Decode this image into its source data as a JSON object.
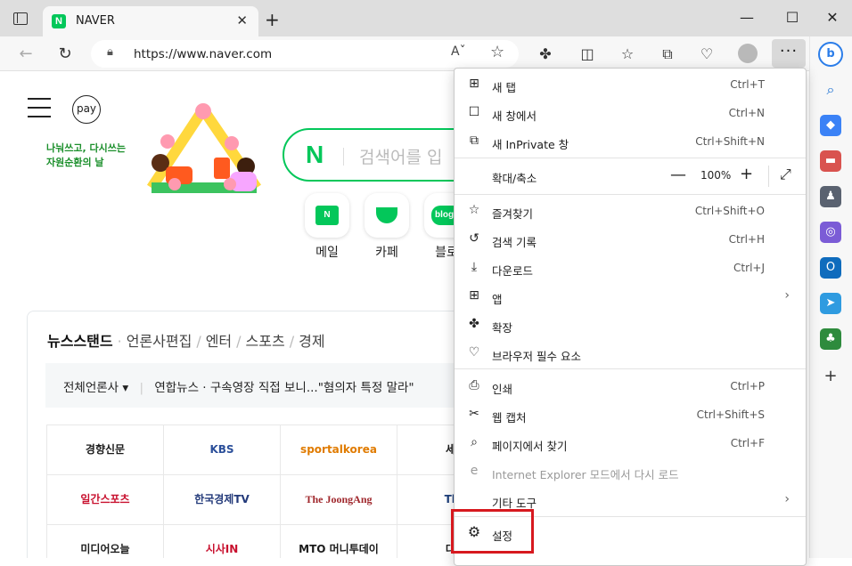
{
  "browser": {
    "tab_title": "NAVER",
    "tab_favicon": "N",
    "new_tab_glyph": "+",
    "url": "https://www.naver.com",
    "read_aloud": "Aˇ",
    "more_glyph": "···"
  },
  "page": {
    "pay_label": "pay",
    "slogan_line1": "나눠쓰고, 다시쓰는",
    "slogan_line2": "자원순환의 날",
    "search_logo": "N",
    "search_placeholder": "검색어를 입",
    "services": [
      {
        "label": "메일"
      },
      {
        "label": "카페"
      },
      {
        "label": "블로"
      }
    ],
    "news_tabs": [
      "뉴스스탠드",
      "언론사편집",
      "엔터",
      "스포츠",
      "경제"
    ],
    "news_filter": "전체언론사 ▾",
    "news_headline": "연합뉴스 · 구속영장 직접 보니...\"혐의자 특정 말라\"",
    "press": [
      [
        "경향신문",
        "KBS",
        "sportalkorea",
        "세계"
      ],
      [
        "일간스포츠",
        "한국경제TV",
        "The JoongAng",
        "The"
      ],
      [
        "미디어오늘",
        "시사IN",
        "MTO 머니투데이",
        "대구"
      ]
    ]
  },
  "menu": {
    "items": [
      {
        "icon": "new-tab-icon",
        "glyph": "⊞",
        "label": "새 탭",
        "shortcut": "Ctrl+T"
      },
      {
        "icon": "new-window-icon",
        "glyph": "☐",
        "label": "새 창에서",
        "shortcut": "Ctrl+N"
      },
      {
        "icon": "inprivate-icon",
        "glyph": "⧉",
        "label": "새 InPrivate 창",
        "shortcut": "Ctrl+Shift+N"
      },
      {
        "icon": "favorites-icon",
        "glyph": "☆",
        "label": "즐겨찾기",
        "shortcut": "Ctrl+Shift+O"
      },
      {
        "icon": "history-icon",
        "glyph": "↺",
        "label": "검색 기록",
        "shortcut": "Ctrl+H"
      },
      {
        "icon": "download-icon",
        "glyph": "⤓",
        "label": "다운로드",
        "shortcut": "Ctrl+J"
      },
      {
        "icon": "apps-icon",
        "glyph": "⊞",
        "label": "앱",
        "shortcut": ""
      },
      {
        "icon": "extensions-icon",
        "glyph": "✤",
        "label": "확장",
        "shortcut": ""
      },
      {
        "icon": "browser-essentials-icon",
        "glyph": "♡",
        "label": "브라우저 필수 요소",
        "shortcut": ""
      },
      {
        "icon": "print-icon",
        "glyph": "⎙",
        "label": "인쇄",
        "shortcut": "Ctrl+P"
      },
      {
        "icon": "web-capture-icon",
        "glyph": "✂",
        "label": "웹 캡처",
        "shortcut": "Ctrl+Shift+S"
      },
      {
        "icon": "find-icon",
        "glyph": "⌕",
        "label": "페이지에서 찾기",
        "shortcut": "Ctrl+F"
      },
      {
        "icon": "ie-mode-icon",
        "glyph": "e",
        "label": "Internet Explorer 모드에서 다시 로드",
        "shortcut": ""
      },
      {
        "icon": "more-tools-icon",
        "glyph": "",
        "label": "기타 도구",
        "shortcut": ""
      },
      {
        "icon": "settings-icon",
        "glyph": "⚙",
        "label": "설정",
        "shortcut": ""
      }
    ],
    "zoom_label": "확대/축소",
    "zoom_value": "100%",
    "zoom_minus": "—",
    "zoom_plus": "+",
    "fullscreen_glyph": "⤢",
    "submenu_arrow": "›"
  },
  "colors": {
    "highlight": "#d7191f",
    "naver_green": "#03c75a"
  }
}
